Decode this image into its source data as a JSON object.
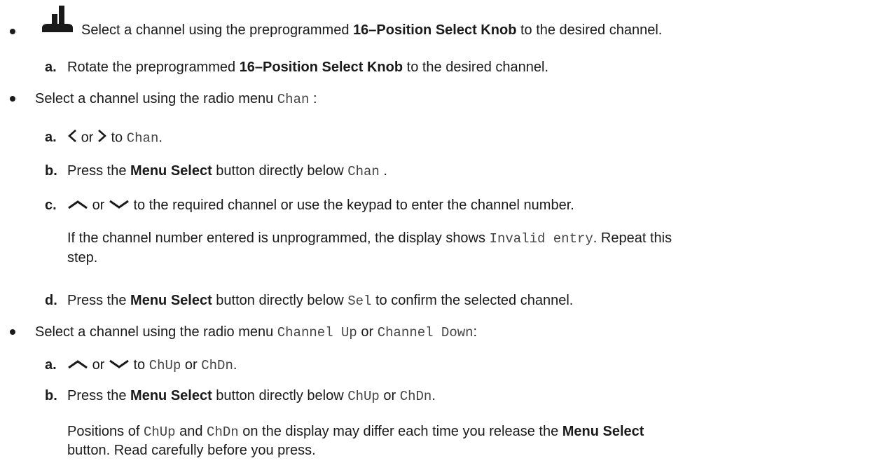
{
  "colors": {
    "text": "#1a1a1a",
    "mono_text": "#444444",
    "background": "#ffffff"
  },
  "b1": {
    "icon": "dedicated-knob-icon",
    "t1": "Select a channel using the preprogrammed ",
    "bold1": "16–Position Select Knob",
    "t2": " to the desired channel.",
    "stepA": {
      "letter": "a.",
      "t1": "Rotate the preprogrammed ",
      "bold1": "16–Position Select Knob",
      "t2": " to the desired channel."
    }
  },
  "b2": {
    "t1": "Select a channel using the radio menu ",
    "mono1": "Chan",
    "t2": " :",
    "stepA": {
      "letter": "a.",
      "left_icon": "left-arrow-icon",
      "or": "or",
      "right_icon": "right-arrow-icon",
      "t1": "to ",
      "mono1": "Chan",
      "t2": "."
    },
    "stepB": {
      "letter": "b.",
      "t1": "Press the ",
      "bold1": "Menu Select",
      "t2": " button directly below ",
      "mono1": "Chan",
      "t3": " ."
    },
    "stepC": {
      "letter": "c.",
      "up_icon": "up-arrow-icon",
      "or": "or",
      "down_icon": "down-arrow-icon",
      "t1": "to the required channel or use the keypad to enter the channel number.",
      "note1": "If the channel number entered is unprogrammed, the display shows ",
      "mono1": "Invalid entry",
      "note2": ". Repeat this",
      "note3": "step."
    },
    "stepD": {
      "letter": "d.",
      "t1": "Press the ",
      "bold1": "Menu Select",
      "t2": " button directly below ",
      "mono1": "Sel",
      "t3": " to confirm the selected channel."
    }
  },
  "b3": {
    "t1": "Select a channel using the radio menu ",
    "mono1": "Channel Up",
    "t2": " or ",
    "mono2": "Channel Down",
    "t3": ":",
    "stepA": {
      "letter": "a.",
      "up_icon": "up-arrow-icon",
      "or": "or",
      "down_icon": "down-arrow-icon",
      "t1": "to ",
      "mono1": "ChUp",
      "t2": " or ",
      "mono2": "ChDn",
      "t3": "."
    },
    "stepB": {
      "letter": "b.",
      "t1": "Press the ",
      "bold1": "Menu Select",
      "t2": " button directly below ",
      "mono1": "ChUp",
      "t3": " or ",
      "mono2": "ChDn",
      "t4": "."
    },
    "note": {
      "t1": "Positions of ",
      "mono1": "ChUp",
      "t2": " and ",
      "mono2": "ChDn",
      "t3": " on the display may differ each time you release the ",
      "bold1": "Menu Select",
      "t4": "button. Read carefully before you press."
    }
  }
}
